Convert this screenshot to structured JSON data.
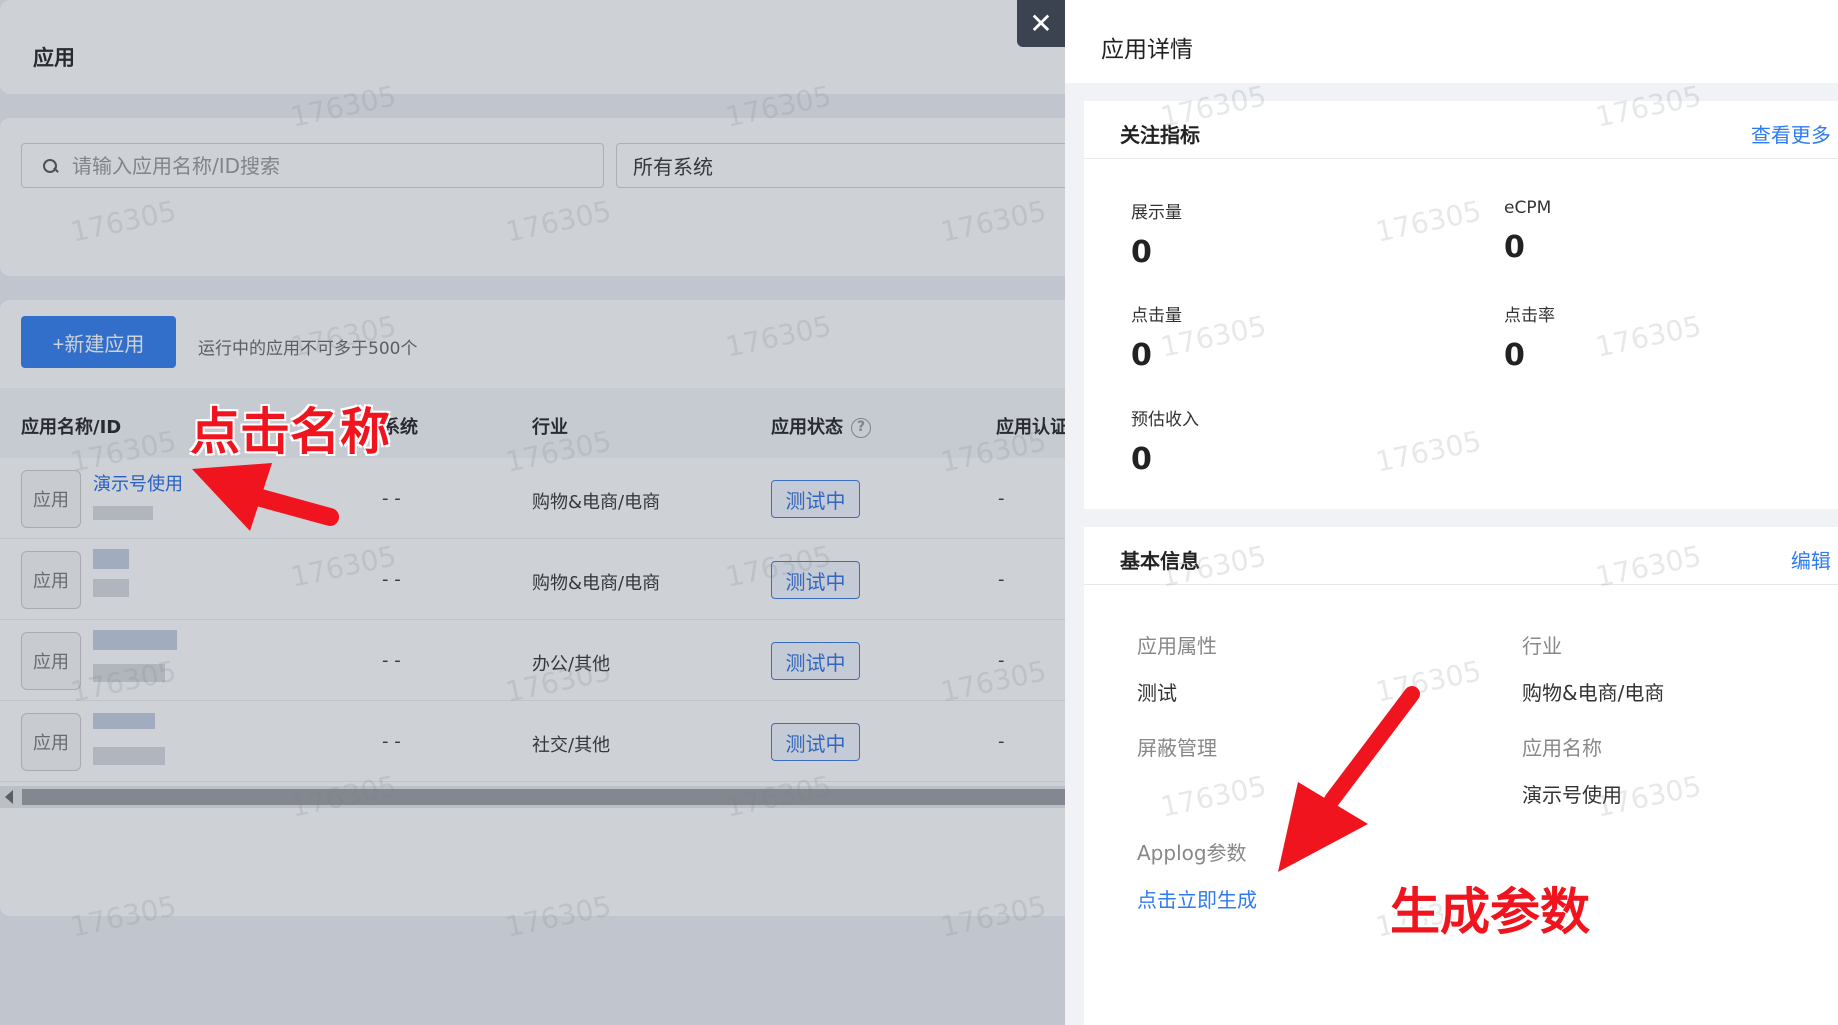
{
  "page": {
    "title": "应用",
    "search_placeholder": "请输入应用名称/ID搜索",
    "system_select": "所有系统",
    "new_button": "+新建应用",
    "hint": "运行中的应用不可多于500个",
    "columns": [
      "应用名称/ID",
      "系统",
      "行业",
      "应用状态",
      "应用认证"
    ],
    "help_icon": "?",
    "rows": [
      {
        "icon": "应用",
        "name": "演示号使用",
        "system": "- -",
        "industry": "购物&电商/电商",
        "status": "测试中",
        "cert": "-"
      },
      {
        "icon": "应用",
        "name": "",
        "system": "- -",
        "industry": "购物&电商/电商",
        "status": "测试中",
        "cert": "-"
      },
      {
        "icon": "应用",
        "name": "",
        "system": "- -",
        "industry": "办公/其他",
        "status": "测试中",
        "cert": "-"
      },
      {
        "icon": "应用",
        "name": "",
        "system": "- -",
        "industry": "社交/其他",
        "status": "测试中",
        "cert": "-"
      }
    ]
  },
  "drawer": {
    "title": "应用详情",
    "close": "✕",
    "metrics": {
      "label": "关注指标",
      "more": "查看更多 >",
      "items": [
        {
          "key": "展示量",
          "value": "0"
        },
        {
          "key": "eCPM",
          "value": "0"
        },
        {
          "key": "点击量",
          "value": "0"
        },
        {
          "key": "点击率",
          "value": "0"
        },
        {
          "key": "预估收入",
          "value": "0"
        }
      ]
    },
    "basic": {
      "label": "基本信息",
      "edit": "编辑 >",
      "items": [
        {
          "key": "应用属性",
          "value": "测试"
        },
        {
          "key": "行业",
          "value": "购物&电商/电商"
        },
        {
          "key": "屏蔽管理",
          "value": ""
        },
        {
          "key": "应用名称",
          "value": "演示号使用"
        },
        {
          "key": "Applog参数",
          "value": "点击立即生成"
        }
      ]
    }
  },
  "annotations": {
    "click_name": "点击名称",
    "gen_params": "生成参数",
    "color": "#f0141e"
  },
  "watermark": "176305"
}
